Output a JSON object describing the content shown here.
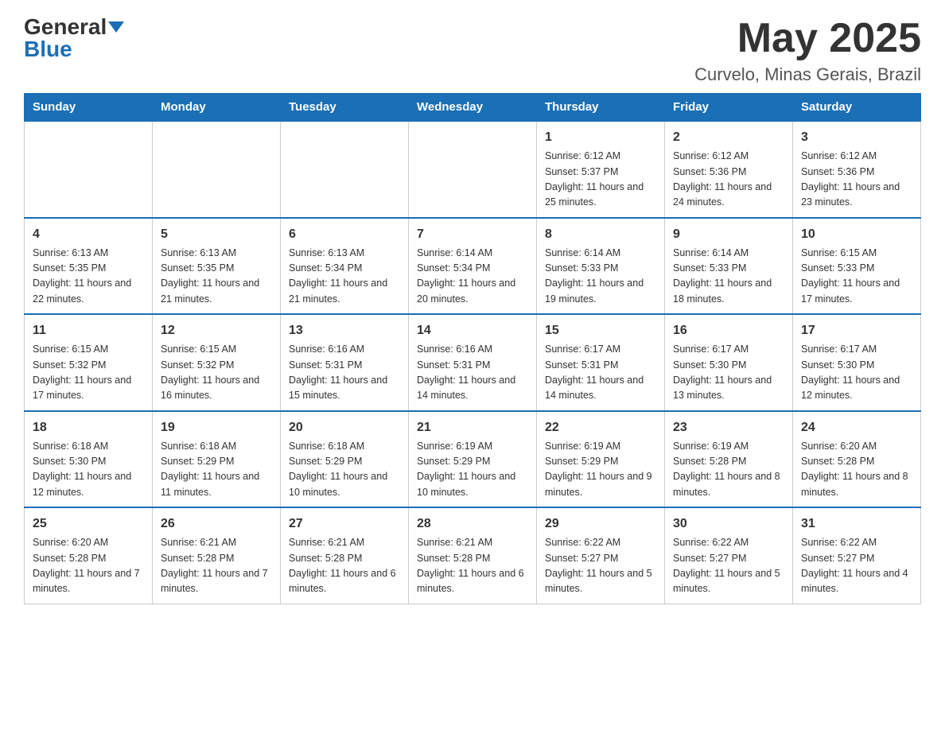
{
  "header": {
    "logo_general": "General",
    "logo_blue": "Blue",
    "month_year": "May 2025",
    "location": "Curvelo, Minas Gerais, Brazil"
  },
  "days_of_week": [
    "Sunday",
    "Monday",
    "Tuesday",
    "Wednesday",
    "Thursday",
    "Friday",
    "Saturday"
  ],
  "weeks": [
    [
      {
        "day": "",
        "info": ""
      },
      {
        "day": "",
        "info": ""
      },
      {
        "day": "",
        "info": ""
      },
      {
        "day": "",
        "info": ""
      },
      {
        "day": "1",
        "info": "Sunrise: 6:12 AM\nSunset: 5:37 PM\nDaylight: 11 hours and 25 minutes."
      },
      {
        "day": "2",
        "info": "Sunrise: 6:12 AM\nSunset: 5:36 PM\nDaylight: 11 hours and 24 minutes."
      },
      {
        "day": "3",
        "info": "Sunrise: 6:12 AM\nSunset: 5:36 PM\nDaylight: 11 hours and 23 minutes."
      }
    ],
    [
      {
        "day": "4",
        "info": "Sunrise: 6:13 AM\nSunset: 5:35 PM\nDaylight: 11 hours and 22 minutes."
      },
      {
        "day": "5",
        "info": "Sunrise: 6:13 AM\nSunset: 5:35 PM\nDaylight: 11 hours and 21 minutes."
      },
      {
        "day": "6",
        "info": "Sunrise: 6:13 AM\nSunset: 5:34 PM\nDaylight: 11 hours and 21 minutes."
      },
      {
        "day": "7",
        "info": "Sunrise: 6:14 AM\nSunset: 5:34 PM\nDaylight: 11 hours and 20 minutes."
      },
      {
        "day": "8",
        "info": "Sunrise: 6:14 AM\nSunset: 5:33 PM\nDaylight: 11 hours and 19 minutes."
      },
      {
        "day": "9",
        "info": "Sunrise: 6:14 AM\nSunset: 5:33 PM\nDaylight: 11 hours and 18 minutes."
      },
      {
        "day": "10",
        "info": "Sunrise: 6:15 AM\nSunset: 5:33 PM\nDaylight: 11 hours and 17 minutes."
      }
    ],
    [
      {
        "day": "11",
        "info": "Sunrise: 6:15 AM\nSunset: 5:32 PM\nDaylight: 11 hours and 17 minutes."
      },
      {
        "day": "12",
        "info": "Sunrise: 6:15 AM\nSunset: 5:32 PM\nDaylight: 11 hours and 16 minutes."
      },
      {
        "day": "13",
        "info": "Sunrise: 6:16 AM\nSunset: 5:31 PM\nDaylight: 11 hours and 15 minutes."
      },
      {
        "day": "14",
        "info": "Sunrise: 6:16 AM\nSunset: 5:31 PM\nDaylight: 11 hours and 14 minutes."
      },
      {
        "day": "15",
        "info": "Sunrise: 6:17 AM\nSunset: 5:31 PM\nDaylight: 11 hours and 14 minutes."
      },
      {
        "day": "16",
        "info": "Sunrise: 6:17 AM\nSunset: 5:30 PM\nDaylight: 11 hours and 13 minutes."
      },
      {
        "day": "17",
        "info": "Sunrise: 6:17 AM\nSunset: 5:30 PM\nDaylight: 11 hours and 12 minutes."
      }
    ],
    [
      {
        "day": "18",
        "info": "Sunrise: 6:18 AM\nSunset: 5:30 PM\nDaylight: 11 hours and 12 minutes."
      },
      {
        "day": "19",
        "info": "Sunrise: 6:18 AM\nSunset: 5:29 PM\nDaylight: 11 hours and 11 minutes."
      },
      {
        "day": "20",
        "info": "Sunrise: 6:18 AM\nSunset: 5:29 PM\nDaylight: 11 hours and 10 minutes."
      },
      {
        "day": "21",
        "info": "Sunrise: 6:19 AM\nSunset: 5:29 PM\nDaylight: 11 hours and 10 minutes."
      },
      {
        "day": "22",
        "info": "Sunrise: 6:19 AM\nSunset: 5:29 PM\nDaylight: 11 hours and 9 minutes."
      },
      {
        "day": "23",
        "info": "Sunrise: 6:19 AM\nSunset: 5:28 PM\nDaylight: 11 hours and 8 minutes."
      },
      {
        "day": "24",
        "info": "Sunrise: 6:20 AM\nSunset: 5:28 PM\nDaylight: 11 hours and 8 minutes."
      }
    ],
    [
      {
        "day": "25",
        "info": "Sunrise: 6:20 AM\nSunset: 5:28 PM\nDaylight: 11 hours and 7 minutes."
      },
      {
        "day": "26",
        "info": "Sunrise: 6:21 AM\nSunset: 5:28 PM\nDaylight: 11 hours and 7 minutes."
      },
      {
        "day": "27",
        "info": "Sunrise: 6:21 AM\nSunset: 5:28 PM\nDaylight: 11 hours and 6 minutes."
      },
      {
        "day": "28",
        "info": "Sunrise: 6:21 AM\nSunset: 5:28 PM\nDaylight: 11 hours and 6 minutes."
      },
      {
        "day": "29",
        "info": "Sunrise: 6:22 AM\nSunset: 5:27 PM\nDaylight: 11 hours and 5 minutes."
      },
      {
        "day": "30",
        "info": "Sunrise: 6:22 AM\nSunset: 5:27 PM\nDaylight: 11 hours and 5 minutes."
      },
      {
        "day": "31",
        "info": "Sunrise: 6:22 AM\nSunset: 5:27 PM\nDaylight: 11 hours and 4 minutes."
      }
    ]
  ]
}
